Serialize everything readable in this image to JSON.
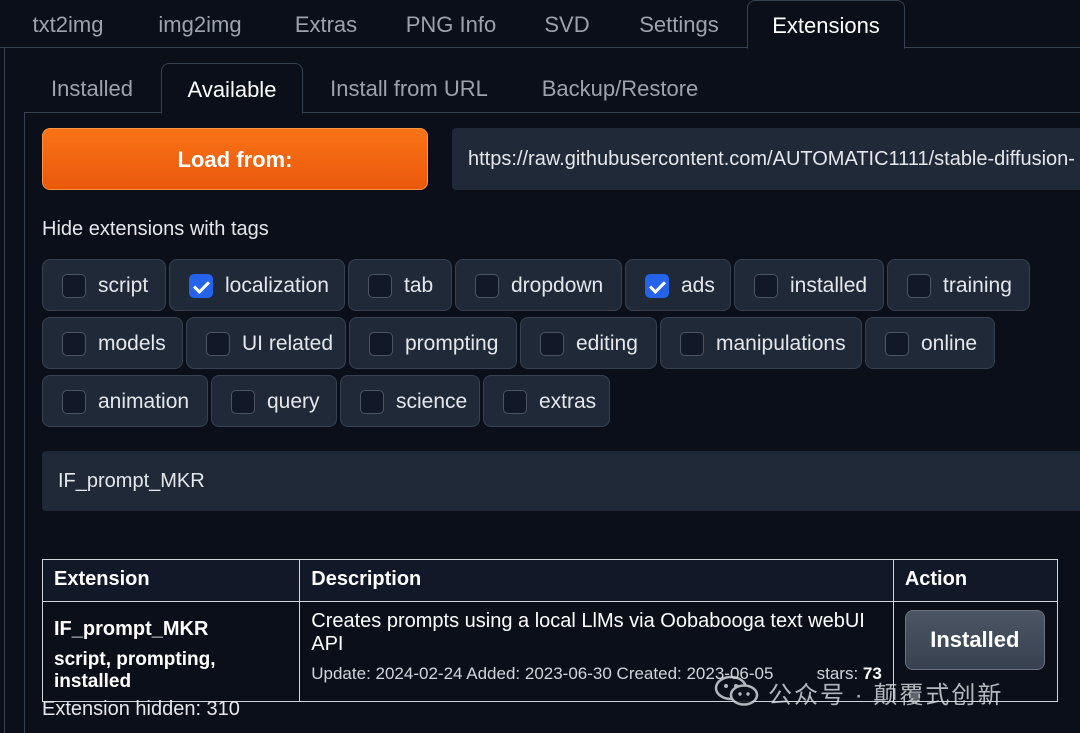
{
  "top_tabs": [
    {
      "label": "txt2img"
    },
    {
      "label": "img2img"
    },
    {
      "label": "Extras"
    },
    {
      "label": "PNG Info"
    },
    {
      "label": "SVD"
    },
    {
      "label": "Settings"
    },
    {
      "label": "Extensions",
      "active": true
    }
  ],
  "sub_tabs": [
    {
      "label": "Installed"
    },
    {
      "label": "Available",
      "active": true
    },
    {
      "label": "Install from URL"
    },
    {
      "label": "Backup/Restore"
    }
  ],
  "load": {
    "button_label": "Load from:",
    "url_value": "https://raw.githubusercontent.com/AUTOMATIC1111/stable-diffusion-"
  },
  "tags": {
    "label": "Hide extensions with tags",
    "items": [
      {
        "label": "script",
        "checked": false
      },
      {
        "label": "localization",
        "checked": true
      },
      {
        "label": "tab",
        "checked": false
      },
      {
        "label": "dropdown",
        "checked": false
      },
      {
        "label": "ads",
        "checked": true
      },
      {
        "label": "installed",
        "checked": false
      },
      {
        "label": "training",
        "checked": false
      },
      {
        "label": "models",
        "checked": false
      },
      {
        "label": "UI related",
        "checked": false
      },
      {
        "label": "prompting",
        "checked": false
      },
      {
        "label": "editing",
        "checked": false
      },
      {
        "label": "manipulations",
        "checked": false
      },
      {
        "label": "online",
        "checked": false
      },
      {
        "label": "animation",
        "checked": false
      },
      {
        "label": "query",
        "checked": false
      },
      {
        "label": "science",
        "checked": false
      },
      {
        "label": "extras",
        "checked": false
      }
    ]
  },
  "search": {
    "value": "IF_prompt_MKR"
  },
  "table": {
    "headers": [
      "Extension",
      "Description",
      "Action"
    ],
    "rows": [
      {
        "name": "IF_prompt_MKR",
        "tags": "script, prompting, installed",
        "description": "Creates prompts using a local LlMs via Oobabooga text webUI API",
        "meta": "Update: 2024-02-24 Added: 2023-06-30 Created: 2023-06-05",
        "stars_label": "stars:",
        "stars": "73",
        "action_label": "Installed"
      }
    ]
  },
  "hidden_count": "Extension hidden: 310",
  "watermark": {
    "text": "公众号 · 颠覆式创新",
    "icon": "wechat-icon"
  },
  "colors": {
    "background": "#0b0f19",
    "accent_orange": "#f97316",
    "checkbox_blue": "#2563eb"
  }
}
